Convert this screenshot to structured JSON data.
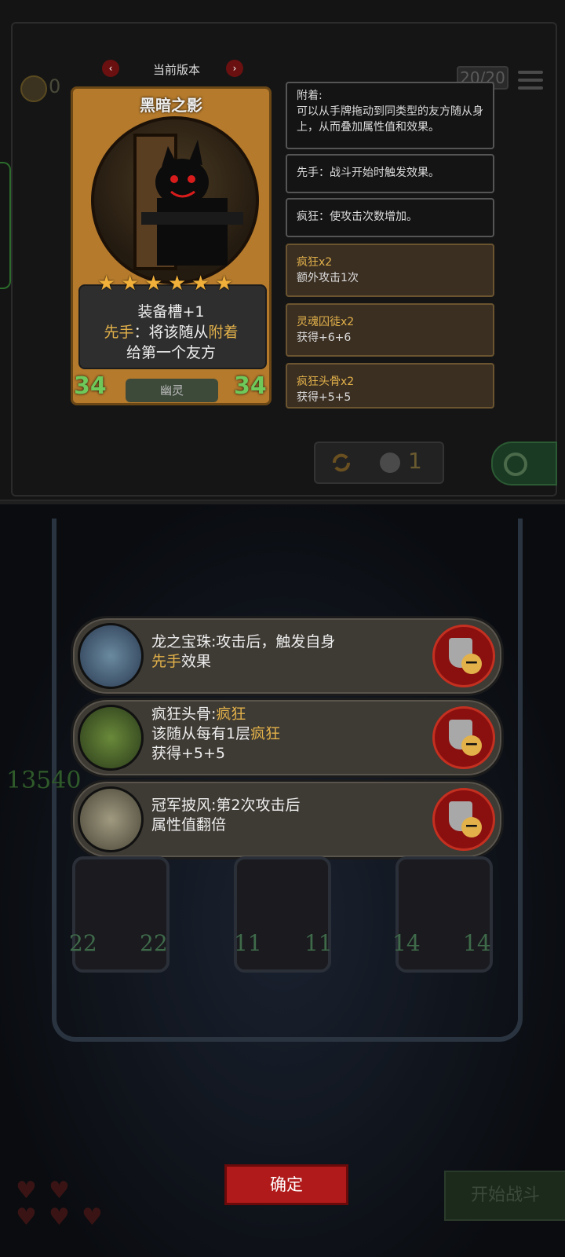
{
  "header": {
    "coins": "0",
    "deck_count": "20/20"
  },
  "version_nav": {
    "title": "当前版本",
    "prev": "‹",
    "next": "›"
  },
  "card": {
    "name": "黑暗之影",
    "stars": [
      "★",
      "★",
      "★",
      "★",
      "★",
      "★"
    ],
    "desc_line1": "装备槽+1",
    "desc_l2_a": "先手",
    "desc_l2_b": "：将该随从",
    "desc_l2_c": "附着",
    "desc_line3": "给第一个友方",
    "attack": "34",
    "health": "34",
    "tribe": "幽灵"
  },
  "info_boxes": [
    {
      "title": "附着:",
      "body": "可以从手牌拖动到同类型的友方随从身上，从而叠加属性值和效果。"
    },
    {
      "title": "",
      "body": "先手：战斗开始时触发效果。"
    },
    {
      "title": "",
      "body": "疯狂：使攻击次数增加。"
    },
    {
      "title": "疯狂x2",
      "body": "额外攻击1次"
    },
    {
      "title": "灵魂囚徒x2",
      "body": "获得+6+6"
    },
    {
      "title": "疯狂头骨x2",
      "body": "获得+5+5"
    }
  ],
  "reroll": {
    "count": "1"
  },
  "powerups": [
    {
      "l1a": "龙之宝珠:攻击后，触发自身",
      "l1b": "",
      "l2a": "先手",
      "l2b": "效果",
      "l3": ""
    },
    {
      "l1a": "疯狂头骨:",
      "l1b": "疯狂",
      "l2a": "该随从每有1层",
      "l2b": "疯狂",
      "l3": "获得+5+5"
    },
    {
      "l1a": "冠军披风:第2次攻击后",
      "l1b": "",
      "l2a": "属性值翻倍",
      "l2b": "",
      "l3": ""
    }
  ],
  "board": {
    "score": "13540",
    "units": [
      {
        "atk": "22",
        "hp": "22"
      },
      {
        "atk": "11",
        "hp": "11"
      },
      {
        "atk": "14",
        "hp": "14"
      }
    ]
  },
  "buttons": {
    "confirm": "确定",
    "start": "开始战斗"
  }
}
